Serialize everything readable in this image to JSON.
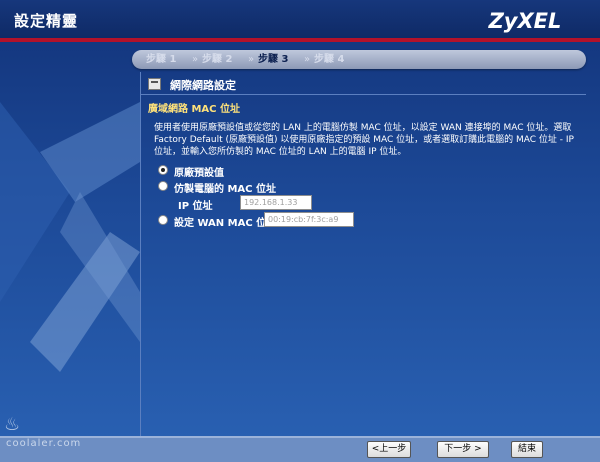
{
  "window": {
    "title": "設定精靈"
  },
  "brand": {
    "logo": "ZyXEL"
  },
  "steps": [
    {
      "label": "步驟 1",
      "active": false
    },
    {
      "label": "步驟 2",
      "active": false
    },
    {
      "label": "步驟 3",
      "active": true
    },
    {
      "label": "步驟 4",
      "active": false
    }
  ],
  "step_separator": "»",
  "section": {
    "title": "網際網路設定",
    "subtitle": "廣域網路 MAC 位址",
    "description": "使用者使用原廠預設值或從您的 LAN 上的電腦仿製 MAC 位址，以設定 WAN 連接埠的 MAC 位址。選取 Factory Default (原廠預設值) 以使用原廠指定的預設 MAC 位址，或者選取訂購此電腦的 MAC 位址 - IP 位址，並輸入您所仿製的 MAC 位址的 LAN 上的電腦 IP 位址。"
  },
  "options": {
    "factory_default": {
      "label": "原廠預設值",
      "selected": true
    },
    "clone_mac": {
      "label": "仿製電腦的 MAC 位址",
      "selected": false
    },
    "ip_label": "IP 位址",
    "ip_placeholder": "192.168.1.33",
    "set_wan_mac": {
      "label": "設定 WAN MAC 位址",
      "selected": false
    },
    "wan_mac_placeholder": "00:19:cb:7f:3c:a9"
  },
  "buttons": {
    "back": "<上一步",
    "next": "下一步 >",
    "finish": "結束"
  },
  "watermark": "coolaler.com",
  "colors": {
    "header_accent": "#b3122a",
    "subtitle": "#ffe27a",
    "background": "#1d4a98"
  }
}
